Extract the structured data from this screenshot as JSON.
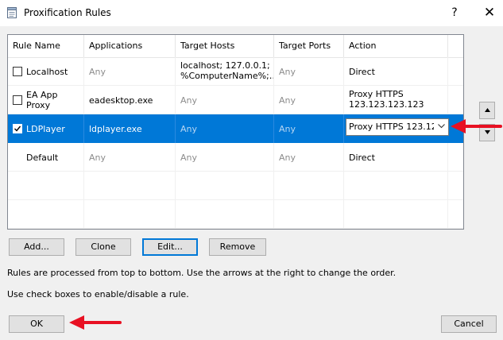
{
  "window": {
    "title": "Proxification Rules",
    "help_label": "?",
    "close_label": "✕"
  },
  "table": {
    "columns": [
      "Rule Name",
      "Applications",
      "Target Hosts",
      "Target Ports",
      "Action"
    ],
    "rows": [
      {
        "enabled": false,
        "has_checkbox": true,
        "name": "Localhost",
        "applications": "Any",
        "target_hosts": [
          "localhost; 127.0.0.1;",
          "%ComputerName%;…"
        ],
        "target_ports": "Any",
        "action": [
          "Direct"
        ]
      },
      {
        "enabled": false,
        "has_checkbox": true,
        "name": "EA App Proxy",
        "applications": "eadesktop.exe",
        "target_hosts": [
          "Any"
        ],
        "target_ports": "Any",
        "action": [
          "Proxy HTTPS",
          "123.123.123.123"
        ]
      },
      {
        "enabled": true,
        "has_checkbox": true,
        "selected": true,
        "name": "LDPlayer",
        "applications": "ldplayer.exe",
        "target_hosts": [
          "Any"
        ],
        "target_ports": "Any",
        "action_combo": "Proxy HTTPS 123.12…"
      },
      {
        "enabled": null,
        "has_checkbox": false,
        "name": "Default",
        "applications": "Any",
        "target_hosts": [
          "Any"
        ],
        "target_ports": "Any",
        "action": [
          "Direct"
        ]
      }
    ]
  },
  "buttons": {
    "add": "Add...",
    "clone": "Clone",
    "edit": "Edit...",
    "remove": "Remove",
    "ok": "OK",
    "cancel": "Cancel"
  },
  "order_buttons": {
    "up_icon": "triangle-up",
    "down_icon": "triangle-down"
  },
  "info": {
    "line1": "Rules are processed from top to bottom. Use the arrows at the right to change the order.",
    "line2": "Use check boxes to enable/disable a rule."
  },
  "colors": {
    "selection": "#0078d7",
    "annotation_arrow": "#e81123",
    "focus_border": "#0078d7"
  }
}
